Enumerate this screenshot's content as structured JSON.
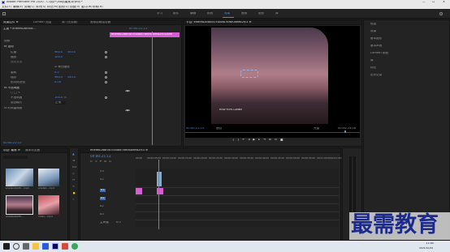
{
  "window": {
    "title": "Adobe Premiere Pro 2020 - C:\\用户\\Vlog\\最美.prproj *",
    "controls": [
      "—",
      "☐",
      "✕"
    ]
  },
  "menu": [
    "文件(F)",
    "编辑(E)",
    "剪辑(C)",
    "序列(S)",
    "标记(M)",
    "图形(G)",
    "视图(V)",
    "窗口(W)",
    "帮助(H)"
  ],
  "workspaces": [
    "学习",
    "组件",
    "编辑",
    "颜色",
    "效果",
    "音频",
    "图形",
    "库"
  ],
  "effect_controls": {
    "tab": "效果控件 ≡",
    "tab2": "Lumetri 范围",
    "tab3": "源: (无剪辑)",
    "tab4": "音频剪辑混合器",
    "source": "主要 * ehefeb2bbf0d...",
    "clip": "ehefeb2bbf0d7c4dda76f6f0aeeb2fc3206f",
    "timecode": "00:00:21:13",
    "rows": [
      {
        "label": "视频",
        "indent": 0
      },
      {
        "label": "fx 运动",
        "indent": 1
      },
      {
        "label": "位置",
        "indent": 2,
        "v1": "960.0",
        "v2": "540.0"
      },
      {
        "label": "缩放",
        "indent": 2,
        "v1": "100.0"
      },
      {
        "label": "缩放宽度",
        "indent": 2,
        "v1": ""
      },
      {
        "label": "☑ 等比缩放",
        "indent": 2,
        "v1": ""
      },
      {
        "label": "旋转",
        "indent": 2,
        "v1": "0.0"
      },
      {
        "label": "锚点",
        "indent": 2,
        "v1": "960.0",
        "v2": "540.0"
      },
      {
        "label": "防闪烁滤镜",
        "indent": 2,
        "v1": "0.00"
      },
      {
        "label": "fx 不透明度",
        "indent": 1
      },
      {
        "label": "○ □ ✎",
        "indent": 2,
        "v1": ""
      },
      {
        "label": "不透明度",
        "indent": 2,
        "v1": "100.0 %"
      },
      {
        "label": "混合模式",
        "indent": 2,
        "v1": "正常"
      },
      {
        "label": "fx 时间重映射",
        "indent": 1
      }
    ],
    "footer_time": "00:00:21:13"
  },
  "program": {
    "tab": "节目: ehefeb2bbf0d7c4dda76f6f0aeeb2fc3 ≡",
    "watermark": "HOW TOYS LAMEN",
    "timecode": "00:00:21:13",
    "fit": "适合",
    "quality": "完整",
    "duration": "00:00:23:16"
  },
  "project": {
    "tab": "项目: 最美 ≡",
    "tab2": "媒体浏览器",
    "items": [
      "ehefeb2bbf0...mp4",
      "ahefeb...mp4",
      "ehefeb2bbf0...",
      "video...mp4"
    ]
  },
  "timeline": {
    "tab": "ehefeb2bbf0d7c4dda76f6f0aeeb2fc3 ≡",
    "timecode": "00:00:21:13",
    "ruler": [
      "00:00",
      "00:00:05:00",
      "00:00:10:00",
      "00:00:15:00",
      "00:00:20:00",
      "00:00:25:00",
      "00:00:30:00",
      "00:00:35:00",
      "00:00:40:00",
      "00:00:45:00",
      "00:00:50:00",
      "00:00:55:00",
      "00:01:00:00",
      "00:01:05:00"
    ],
    "tracks": [
      "V3",
      "V2",
      "V1",
      "A1",
      "A2",
      "A3",
      "主声道"
    ],
    "master_value": "0.0"
  },
  "right_panel": {
    "items": [
      "信息",
      "效果",
      "基本图形",
      "基本声音",
      "Lumetri 颜色",
      "库",
      "标记",
      "历史记录"
    ]
  },
  "brand": "最需教育",
  "taskbar": {
    "time": "11:40",
    "date": "2021/10/22"
  },
  "colors": {
    "accent": "#4b8be8",
    "clip": "#d35fd1",
    "playhead": "#4b8be8"
  }
}
